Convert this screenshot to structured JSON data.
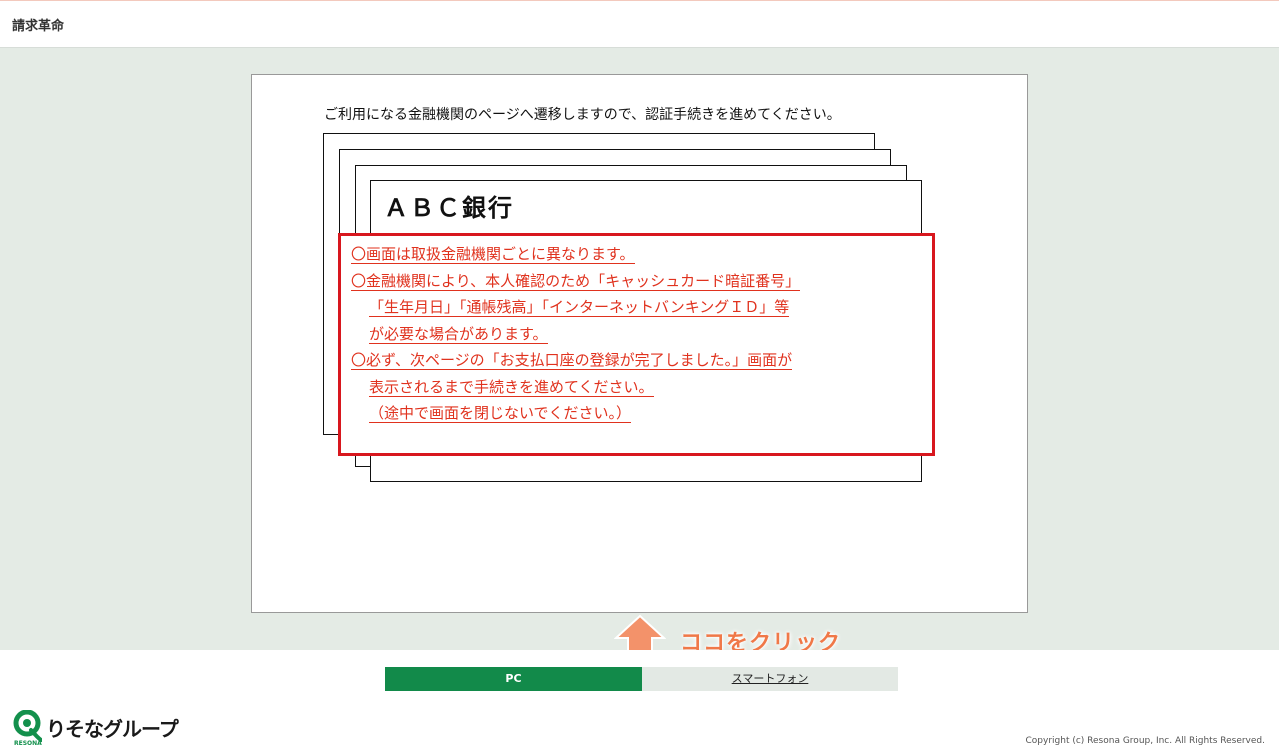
{
  "header": {
    "title": "請求革命"
  },
  "panel": {
    "intro": "ご利用になる金融機関のページへ遷移しますので、認証手続きを進めてください。",
    "bank_name": "ＡＢＣ銀行",
    "notice_lines": [
      "〇画面は取扱金融機関ごとに異なります。",
      "〇金融機関により、本人確認のため「キャッシュカード暗証番号」",
      "「生年月日」「通帳残高」「インターネットバンキングＩＤ」等",
      "が必要な場合があります。",
      "〇必ず、次ページの「お支払口座の登録が完了しました。」画面が",
      "表示されるまで手続きを進めてください。",
      "（途中で画面を閉じないでください。）"
    ]
  },
  "annotation": {
    "label": "ココをクリック",
    "color": "#f07848"
  },
  "footer": {
    "tabs": [
      {
        "label": "PC",
        "active": true
      },
      {
        "label": "スマートフォン",
        "active": false
      }
    ],
    "logo_text": "りそなグループ",
    "logo_sub": "RESONA",
    "copyright": "Copyright (c) Resona Group, Inc. All Rights Reserved."
  },
  "colors": {
    "brand_green": "#128a4a",
    "alert_red": "#d8171e",
    "text_red": "#e0321e"
  }
}
